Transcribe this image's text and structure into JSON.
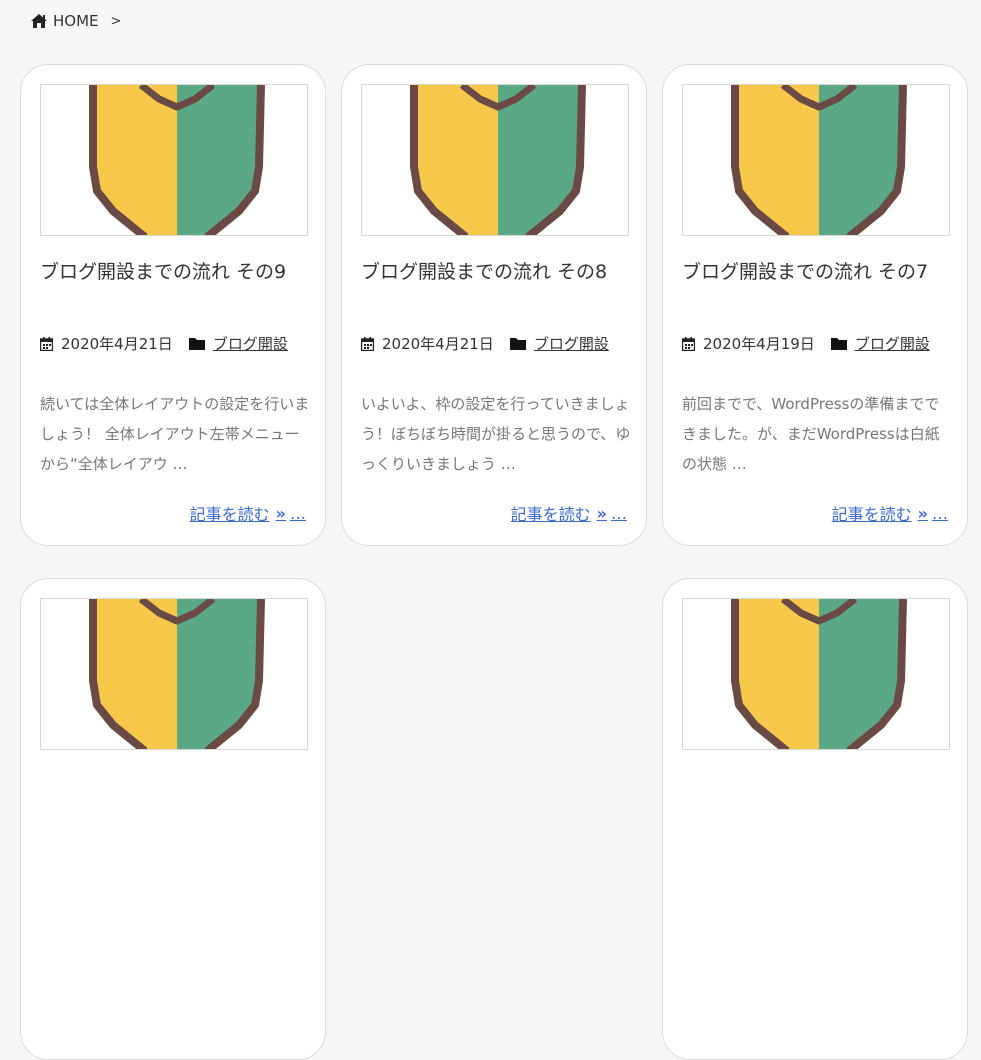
{
  "breadcrumb": {
    "home_label": "HOME",
    "separator": ">"
  },
  "colors": {
    "badge_yellow": "#f8c84a",
    "badge_green": "#5ba886",
    "badge_border": "#6b4a45",
    "link": "#3d6bd1"
  },
  "posts": [
    {
      "title": "ブログ開設までの流れ その9",
      "date": "2020年4月21日",
      "category": "ブログ開設",
      "excerpt": "続いては全体レイアウトの設定を行いましょう！ 全体レイアウト左帯メニューから“全体レイアウ …",
      "read_more": "記事を読む",
      "ellipsis": "…"
    },
    {
      "title": "ブログ開設までの流れ その8",
      "date": "2020年4月21日",
      "category": "ブログ開設",
      "excerpt": "いよいよ、枠の設定を行っていきましょう！ぼちぼち時間が掛ると思うので、ゆっくりいきましょう …",
      "read_more": "記事を読む",
      "ellipsis": "…"
    },
    {
      "title": "ブログ開設までの流れ その7",
      "date": "2020年4月19日",
      "category": "ブログ開設",
      "excerpt": "前回までで、WordPressの準備までできました。が、まだWordPressは白紙の状態 …",
      "read_more": "記事を読む",
      "ellipsis": "…"
    }
  ]
}
